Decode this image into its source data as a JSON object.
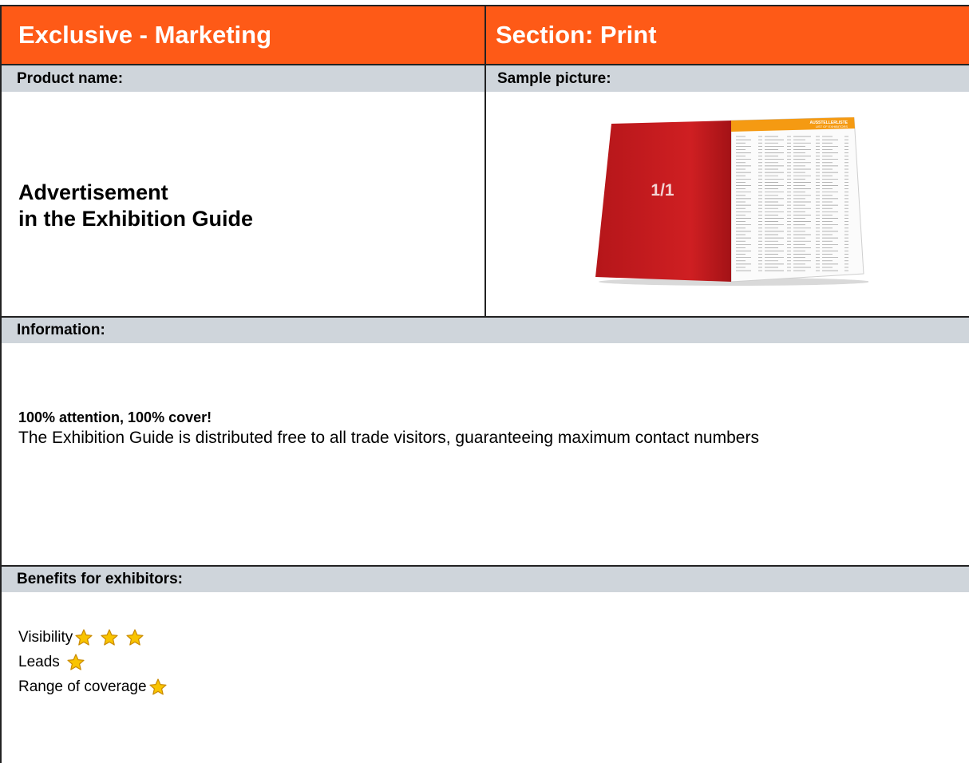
{
  "header": {
    "left_title": "Exclusive - Marketing",
    "right_title": "Section: Print"
  },
  "labels": {
    "product_name": "Product name:",
    "sample_picture": "Sample picture:",
    "information": "Information:",
    "benefits": "Benefits for exhibitors:"
  },
  "product": {
    "line1": "Advertisement",
    "line2": "in the Exhibition Guide"
  },
  "sample": {
    "cover_text": "1/1",
    "page_title": "AUSSTELLERLISTE",
    "page_subtitle": "LIST OF EXHIBITORS"
  },
  "information": {
    "headline": "100% attention, 100% cover!",
    "body": "The Exhibition Guide is distributed free to all trade visitors, guaranteeing maximum contact numbers"
  },
  "benefits": {
    "items": [
      {
        "label": "Visibility",
        "stars": 3
      },
      {
        "label": "Leads",
        "stars": 1
      },
      {
        "label": "Range of coverage",
        "stars": 1
      }
    ]
  },
  "colors": {
    "header_bg": "#fe5a17",
    "label_bar_bg": "#cfd5db",
    "star_fill": "#f9c400",
    "cover_red": "#c8191c",
    "page_orange": "#f59a12"
  }
}
